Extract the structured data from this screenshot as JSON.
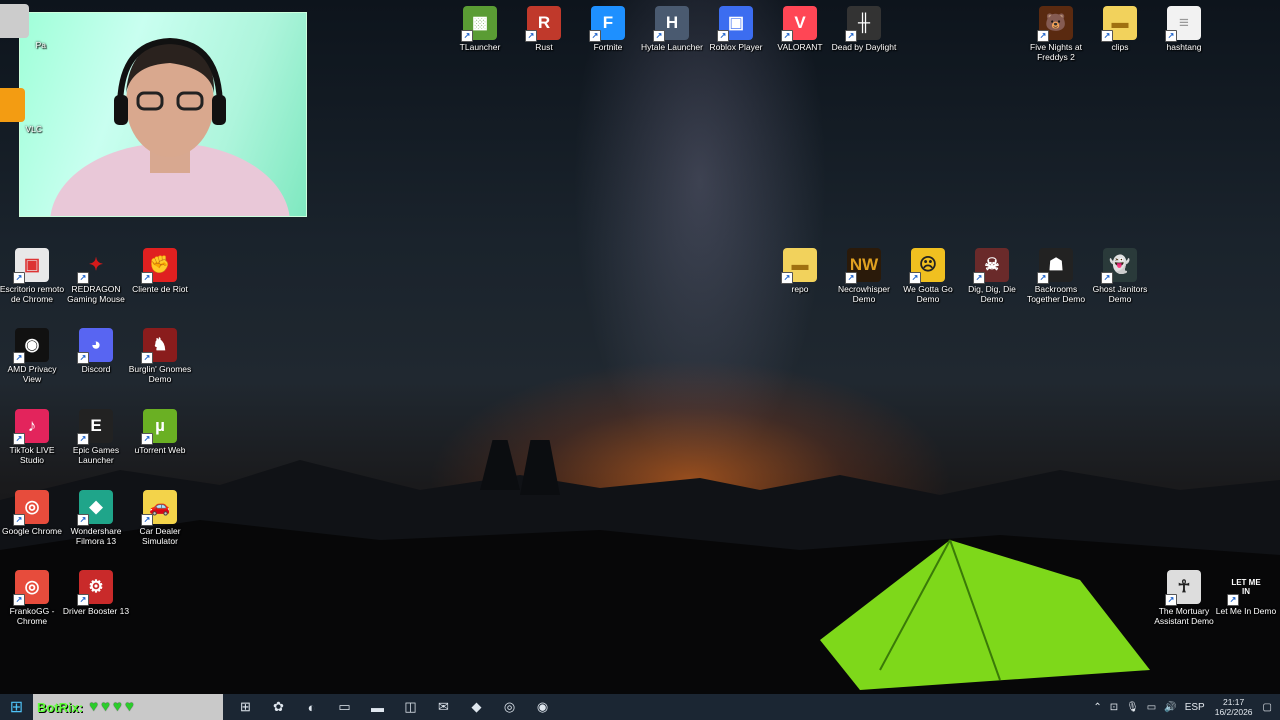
{
  "desktop_icons": {
    "left_col": [
      {
        "label": "Escritorio remoto de Chrome",
        "glyph": "▣",
        "bg": "#e8e8e8",
        "fg": "#d33"
      },
      {
        "label": "REDRAGON Gaming Mouse",
        "glyph": "✦",
        "bg": "transparent",
        "fg": "#d51a1a"
      },
      {
        "label": "Cliente de Riot",
        "glyph": "✊",
        "bg": "#e02020",
        "fg": "#fff"
      },
      {
        "label": "AMD Privacy View",
        "glyph": "◉",
        "bg": "#111",
        "fg": "#fff"
      },
      {
        "label": "Discord",
        "glyph": "◕",
        "bg": "#5865f2",
        "fg": "#fff"
      },
      {
        "label": "Burglin' Gnomes Demo",
        "glyph": "♞",
        "bg": "#8a1c1c",
        "fg": "#fff"
      },
      {
        "label": "TikTok LIVE Studio",
        "glyph": "♪",
        "bg": "#e3245c",
        "fg": "#fff"
      },
      {
        "label": "Epic Games Launcher",
        "glyph": "E",
        "bg": "#222",
        "fg": "#fff"
      },
      {
        "label": "uTorrent Web",
        "glyph": "µ",
        "bg": "#6ab023",
        "fg": "#fff"
      },
      {
        "label": "Google Chrome",
        "glyph": "◎",
        "bg": "#e74c3c",
        "fg": "#fff"
      },
      {
        "label": "Wondershare Filmora 13",
        "glyph": "◆",
        "bg": "#1fa58a",
        "fg": "#fff"
      },
      {
        "label": "Car Dealer Simulator",
        "glyph": "🚗",
        "bg": "#f3d34a",
        "fg": "#222"
      },
      {
        "label": "FrankoGG - Chrome",
        "glyph": "◎",
        "bg": "#e74c3c",
        "fg": "#fff"
      },
      {
        "label": "Driver Booster 13",
        "glyph": "⚙",
        "bg": "#c92a2a",
        "fg": "#fff"
      }
    ],
    "top_row": [
      {
        "label": "TLauncher",
        "glyph": "▩",
        "bg": "#5a9c34",
        "fg": "#fff"
      },
      {
        "label": "Rust",
        "glyph": "R",
        "bg": "#c0392b",
        "fg": "#fff"
      },
      {
        "label": "Fortnite",
        "glyph": "F",
        "bg": "#1e90ff",
        "fg": "#fff"
      },
      {
        "label": "Hytale Launcher",
        "glyph": "H",
        "bg": "#4a5a70",
        "fg": "#fff"
      },
      {
        "label": "Roblox Player",
        "glyph": "▣",
        "bg": "#3c6df0",
        "fg": "#fff"
      },
      {
        "label": "VALORANT",
        "glyph": "V",
        "bg": "#ff4655",
        "fg": "#fff"
      },
      {
        "label": "Dead by Daylight",
        "glyph": "╫",
        "bg": "#333",
        "fg": "#fff"
      }
    ],
    "top_right": [
      {
        "label": "Five Nights at Freddys 2",
        "glyph": "🐻",
        "bg": "#5a2a10",
        "fg": "#fff"
      },
      {
        "label": "clips",
        "glyph": "▬",
        "bg": "#f2d25c",
        "fg": "#a07010"
      },
      {
        "label": "hashtang",
        "glyph": "≡",
        "bg": "#f2f2f2",
        "fg": "#999"
      }
    ],
    "middle_row": [
      {
        "label": "repo",
        "glyph": "▬",
        "bg": "#f2d25c",
        "fg": "#a07010"
      },
      {
        "label": "Necrowhisper Demo",
        "glyph": "NW",
        "bg": "#2a1a0a",
        "fg": "#e0a020"
      },
      {
        "label": "We Gotta Go Demo",
        "glyph": "☹",
        "bg": "#f0c020",
        "fg": "#222"
      },
      {
        "label": "Dig, Dig, Die Demo",
        "glyph": "☠",
        "bg": "#6a2a2a",
        "fg": "#fff"
      },
      {
        "label": "Backrooms Together Demo",
        "glyph": "☗",
        "bg": "#222",
        "fg": "#fff"
      },
      {
        "label": "Ghost Janitors Demo",
        "glyph": "👻",
        "bg": "#2a3a3a",
        "fg": "#fff"
      }
    ],
    "bottom_right": [
      {
        "label": "The Mortuary Assistant Demo",
        "glyph": "☥",
        "bg": "#ddd",
        "fg": "#222"
      },
      {
        "label": "Let Me In Demo",
        "glyph": "LET ME IN",
        "bg": "transparent",
        "fg": "#fff"
      }
    ]
  },
  "partial_left": {
    "p1": "Pa",
    "p2": "VLC"
  },
  "taskbar": {
    "botrix_name": "BotRix:",
    "hearts": [
      "♥",
      "♥",
      "♥",
      "♥"
    ],
    "apps": [
      {
        "name": "task-view-icon",
        "glyph": "⊞"
      },
      {
        "name": "copilot-icon",
        "glyph": "✿"
      },
      {
        "name": "edge-icon",
        "glyph": "◐"
      },
      {
        "name": "window-icon",
        "glyph": "▭"
      },
      {
        "name": "file-explorer-icon",
        "glyph": "▬"
      },
      {
        "name": "store-icon",
        "glyph": "◫"
      },
      {
        "name": "outlook-icon",
        "glyph": "✉"
      },
      {
        "name": "brave-icon",
        "glyph": "◆"
      },
      {
        "name": "chrome-icon",
        "glyph": "◎"
      },
      {
        "name": "obs-icon",
        "glyph": "◉"
      }
    ],
    "tray": {
      "lang": "ESP",
      "time": "21:17",
      "date": "16/2/2026"
    }
  }
}
